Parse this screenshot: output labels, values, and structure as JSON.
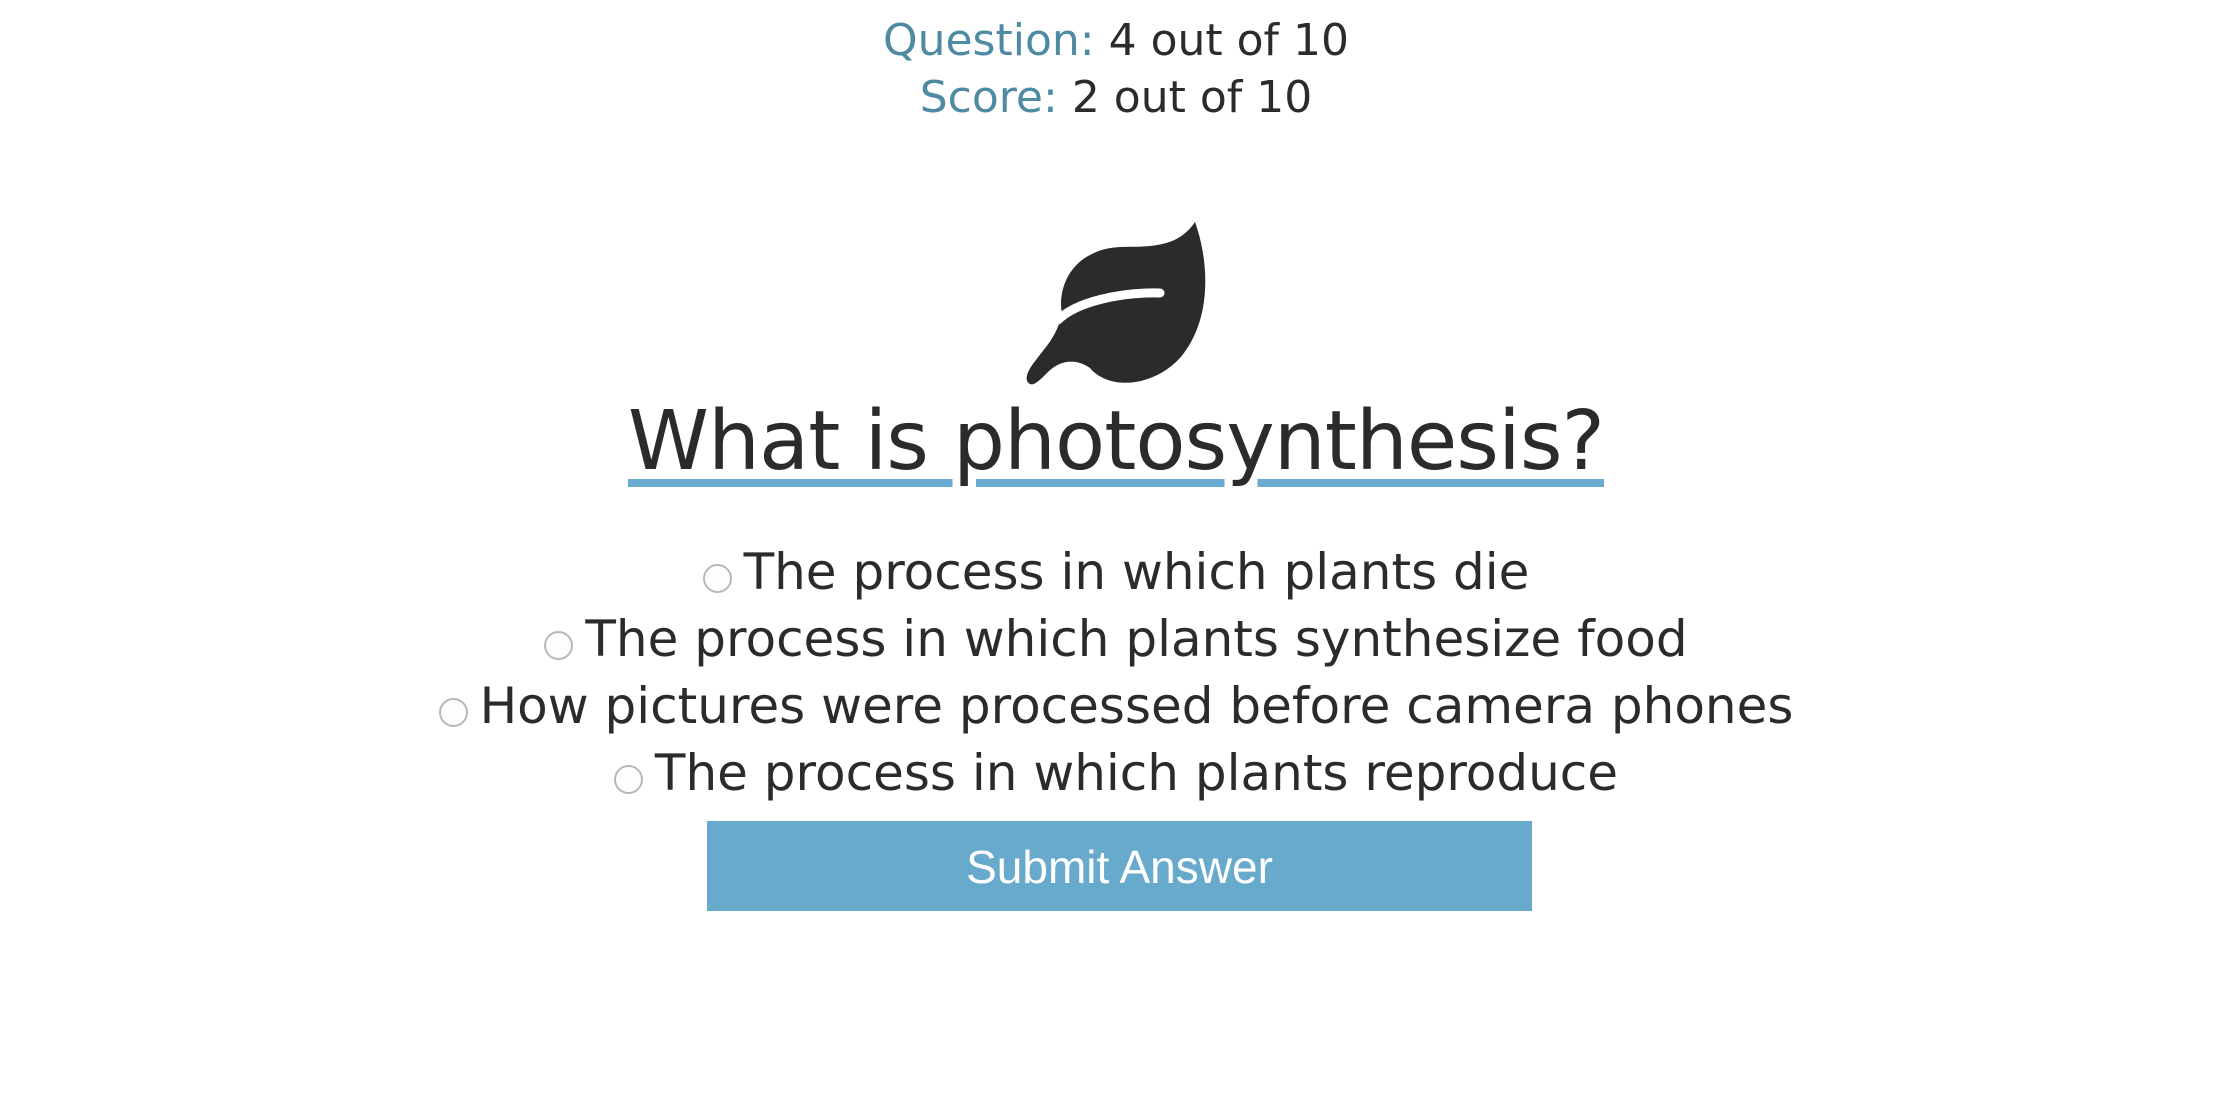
{
  "status": {
    "question_label": "Question:",
    "question_value": "4 out of 10",
    "score_label": "Score:",
    "score_value": "2 out of 10"
  },
  "icon": "leaf-icon",
  "question": {
    "text": "What is photosynthesis?"
  },
  "answers": [
    {
      "label": "The process in which plants die",
      "selected": false
    },
    {
      "label": "The process in which plants synthesize food",
      "selected": false
    },
    {
      "label": "How pictures were processed before camera phones",
      "selected": false
    },
    {
      "label": "The process in which plants reproduce",
      "selected": false
    }
  ],
  "submit": {
    "label": "Submit Answer"
  },
  "colors": {
    "accent": "#68aacb",
    "label": "#4f8aa3",
    "text": "#2b2b2b"
  }
}
